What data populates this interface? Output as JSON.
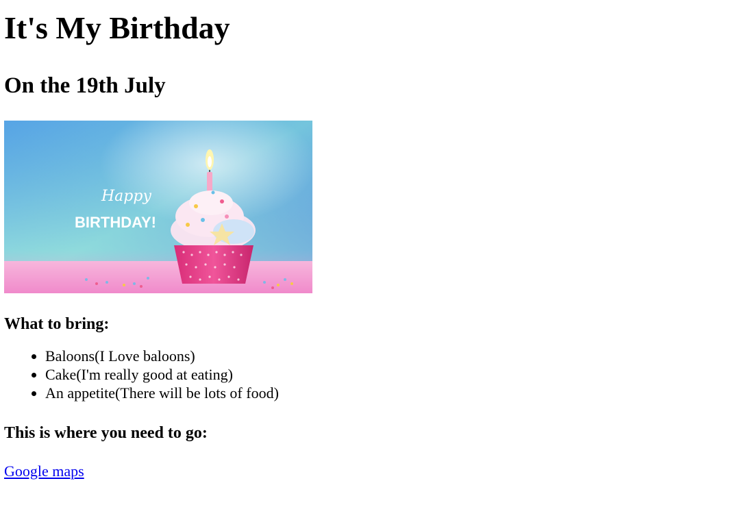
{
  "page": {
    "title": "It's My Birthday",
    "subtitle": "On the 19th July",
    "image": {
      "caption_script": "Happy",
      "caption_caps": "BIRTHDAY!",
      "colors": {
        "sky_top": "#3f6fdc",
        "sky_bottom": "#7fd6d8",
        "table": "#f59ad6",
        "frosting": "#fbe7f2",
        "wrapper": "#e53a84",
        "flame": "#fff6b0"
      }
    },
    "bring_heading": "What to bring:",
    "bring_items": [
      "Baloons(I Love baloons)",
      "Cake(I'm really good at eating)",
      "An appetite(There will be lots of food)"
    ],
    "where_heading": "This is where you need to go:",
    "map_link": "Google maps"
  }
}
